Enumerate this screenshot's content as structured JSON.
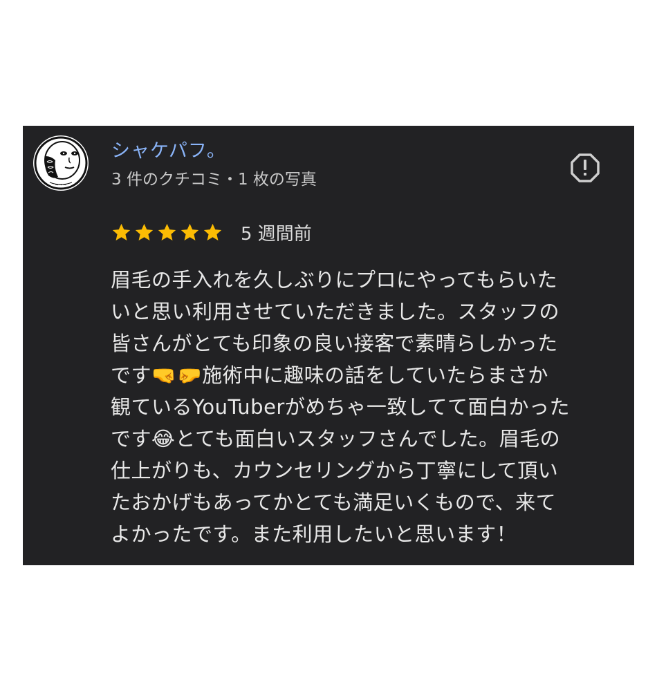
{
  "review": {
    "author_name": "シャケパフ。",
    "author_meta": "3 件のクチコミ・1 枚の写真",
    "rating": 5,
    "rating_max": 5,
    "time_ago": "5 週間前",
    "text_lines": [
      "眉毛の手入れを久しぶりにプロにやってもらいた",
      "いと思い利用させていただきました。スタッフの",
      "皆さんがとても印象の良い接客で素晴らしかった",
      "です🤜🤛施術中に趣味の話をしていたらまさか",
      "観ているYouTuberがめちゃ一致してて面白かった",
      "です😂とても面白いスタッフさんでした。眉毛の",
      "仕上がりも、カウンセリングから丁寧にして頂い",
      "たおかげもあってかとても満足いくもので、来て",
      "よかったです。また利用したいと思います！"
    ]
  },
  "icons": {
    "report": "report-flag-icon",
    "star": "star-icon"
  },
  "colors": {
    "card_background": "#222224",
    "author_link": "#8ab4f8",
    "star": "#fbbc04",
    "text": "#e8e8e8"
  }
}
